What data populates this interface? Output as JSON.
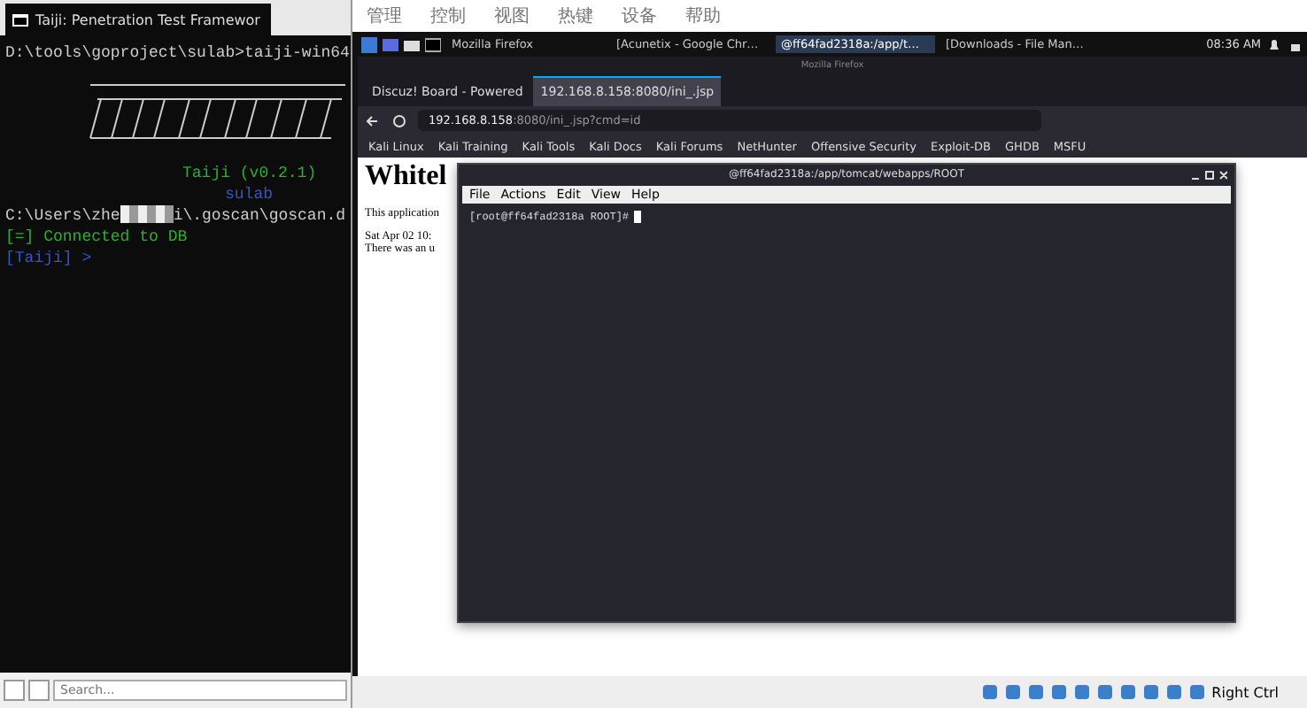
{
  "terminal_window": {
    "tab_title": "Taiji: Penetration Test Framewor",
    "lines": [
      {
        "kind": "plain",
        "text": "D:\\tools\\goproject\\sulab>taiji-win64"
      },
      {
        "kind": "banner"
      },
      {
        "kind": "green",
        "text": "Taiji (v0.2.1)"
      },
      {
        "kind": "blue-center",
        "text": "sulab"
      },
      {
        "kind": "redacted",
        "before": "C:\\Users\\zhe",
        "after": "i\\.goscan\\goscan.d"
      },
      {
        "kind": "green",
        "text": "[=] Connected to DB"
      },
      {
        "kind": "blue",
        "text": "[Taiji] >"
      }
    ],
    "search": {
      "placeholder": "Search..."
    }
  },
  "vm_window": {
    "menu": [
      "管理",
      "控制",
      "视图",
      "热键",
      "设备",
      "帮助"
    ],
    "panel": {
      "tasks": [
        {
          "label": "Mozilla Firefox",
          "selected": false
        },
        {
          "label": "[Acunetix - Google Chr…",
          "selected": false
        },
        {
          "label": "@ff64fad2318a:/app/t…",
          "selected": true
        },
        {
          "label": "[Downloads - File Man…",
          "selected": false
        }
      ],
      "clock": "08:36 AM"
    },
    "browser": {
      "title": "Mozilla Firefox",
      "tabs": [
        {
          "label": "Discuz! Board - Powered",
          "selected": false
        },
        {
          "label": "192.168.8.158:8080/ini_.jsp",
          "selected": true
        }
      ],
      "address": {
        "host": "192.168.8.158",
        "rest": ":8080/ini_.jsp?cmd=id"
      },
      "bookmarks": [
        "Kali Linux",
        "Kali Training",
        "Kali Tools",
        "Kali Docs",
        "Kali Forums",
        "NetHunter",
        "Offensive Security",
        "Exploit-DB",
        "GHDB",
        "MSFU"
      ],
      "page": {
        "heading": "Whitel",
        "lines": [
          "This application",
          "Sat Apr 02 10:",
          "There was an u"
        ]
      }
    },
    "terminal": {
      "title": "@ff64fad2318a:/app/tomcat/webapps/ROOT",
      "menu": [
        "File",
        "Actions",
        "Edit",
        "View",
        "Help"
      ],
      "prompt": "[root@ff64fad2318a ROOT]#"
    },
    "status": {
      "host_key": "Right Ctrl"
    }
  }
}
